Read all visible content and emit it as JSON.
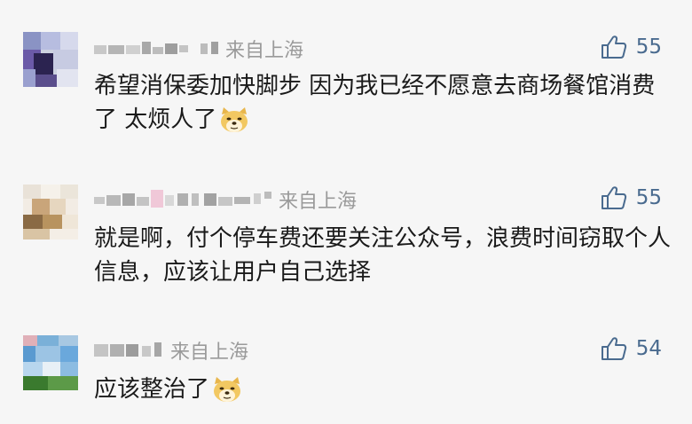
{
  "comments": [
    {
      "location": "来自上海",
      "likes": "55",
      "text": "希望消保委加快脚步 因为我已经不愿意去商场餐馆消费了 太烦人了",
      "emoji": "doge-emoji"
    },
    {
      "location": "来自上海",
      "likes": "55",
      "text": "就是啊，付个停车费还要关注公众号，浪费时间窃取个人信息，应该让用户自己选择",
      "emoji": ""
    },
    {
      "location": "来自上海",
      "likes": "54",
      "text": "应该整治了",
      "emoji": "doge-emoji"
    }
  ],
  "colors": {
    "background": "#f6f6f6",
    "text": "#1a1a1a",
    "meta": "#9a9a9a",
    "like": "#4a6b8f"
  },
  "icons": {
    "like": "thumb-up-icon",
    "avatar": "blurred-avatar",
    "username": "pixelated-username"
  }
}
